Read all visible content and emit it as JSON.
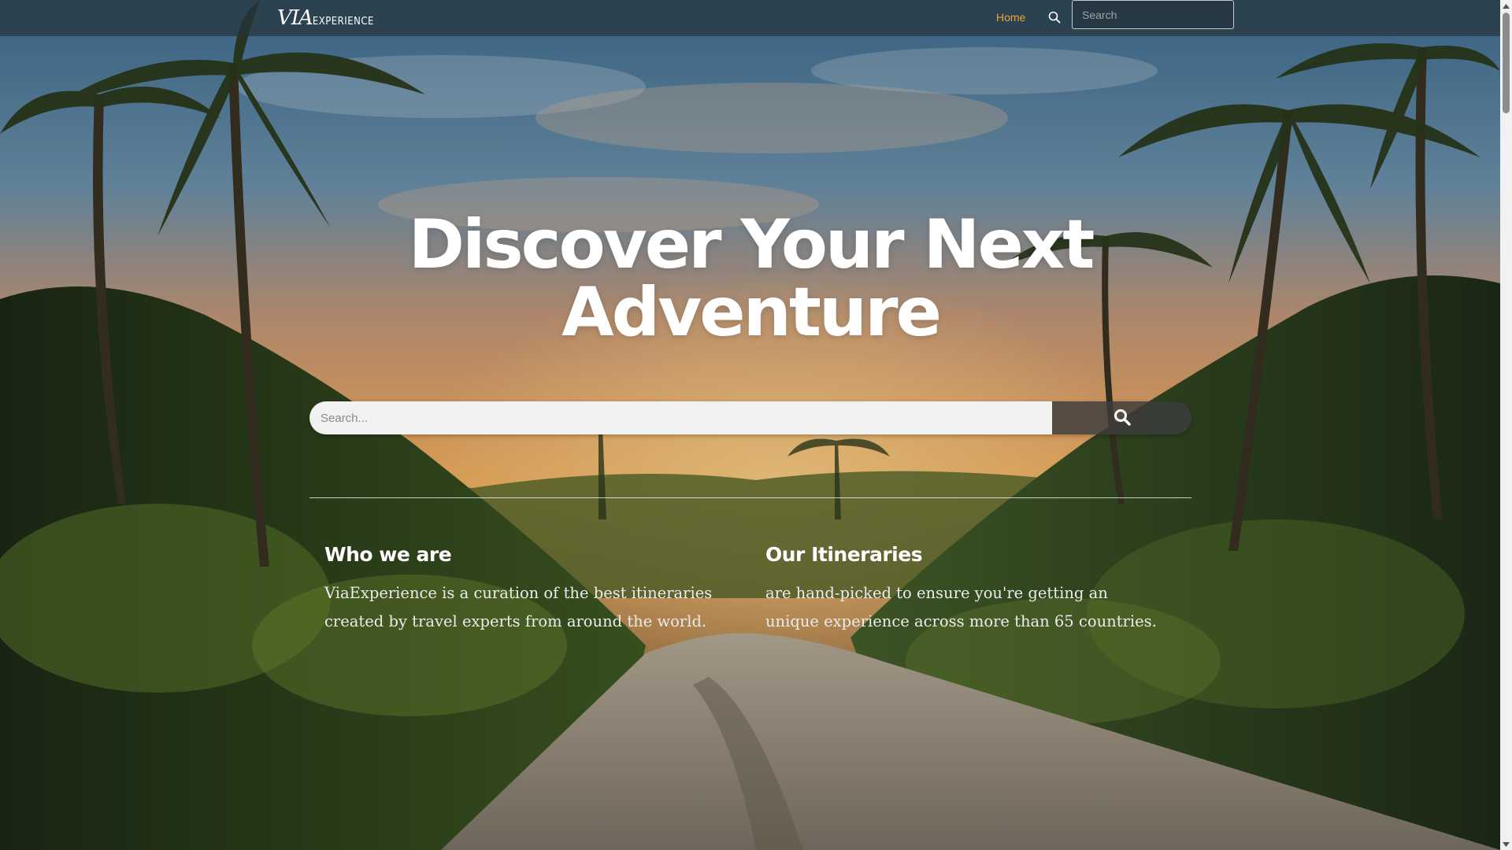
{
  "header": {
    "logo_via": "VIA",
    "logo_experience": "EXPERIENCE",
    "nav_home": "Home",
    "search_placeholder": "Search",
    "search_icon": "search-icon"
  },
  "hero": {
    "title": "Discover Your Next Adventure",
    "search_placeholder": "Search...",
    "search_button_icon": "search-icon"
  },
  "sections": [
    {
      "heading": "Who we are",
      "body": "ViaExperience is a curation of the best itineraries created by travel experts from around the world."
    },
    {
      "heading": "Our Itineraries",
      "body": "are hand-picked to ensure you're getting an unique experience across more than 65 countries."
    }
  ],
  "colors": {
    "nav_active": "#f2a03d",
    "topbar_bg": "#26343c",
    "text": "#ffffff"
  }
}
